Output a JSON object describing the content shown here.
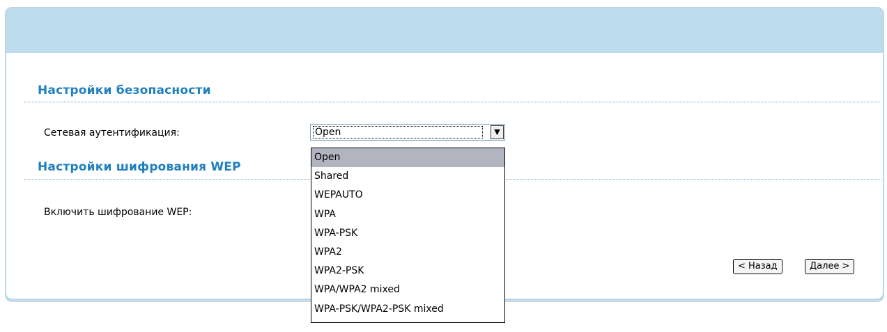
{
  "security_section": {
    "title": "Настройки безопасности",
    "auth_label": "Сетевая аутентификация:",
    "auth_selected": "Open",
    "auth_options": [
      "Open",
      "Shared",
      "WEPAUTO",
      "WPA",
      "WPA-PSK",
      "WPA2",
      "WPA2-PSK",
      "WPA/WPA2 mixed",
      "WPA-PSK/WPA2-PSK mixed"
    ]
  },
  "wep_section": {
    "title": "Настройки шифрования WEP",
    "enable_label": "Включить шифрование WEP:"
  },
  "buttons": {
    "back": "< Назад",
    "next": "Далее >"
  },
  "colors": {
    "header_bg": "#bcdbec",
    "title_color": "#1f7fbf",
    "selected_option_bg": "#b2b4bf"
  },
  "icons": {
    "dropdown_arrow": "chevron-down-icon"
  }
}
